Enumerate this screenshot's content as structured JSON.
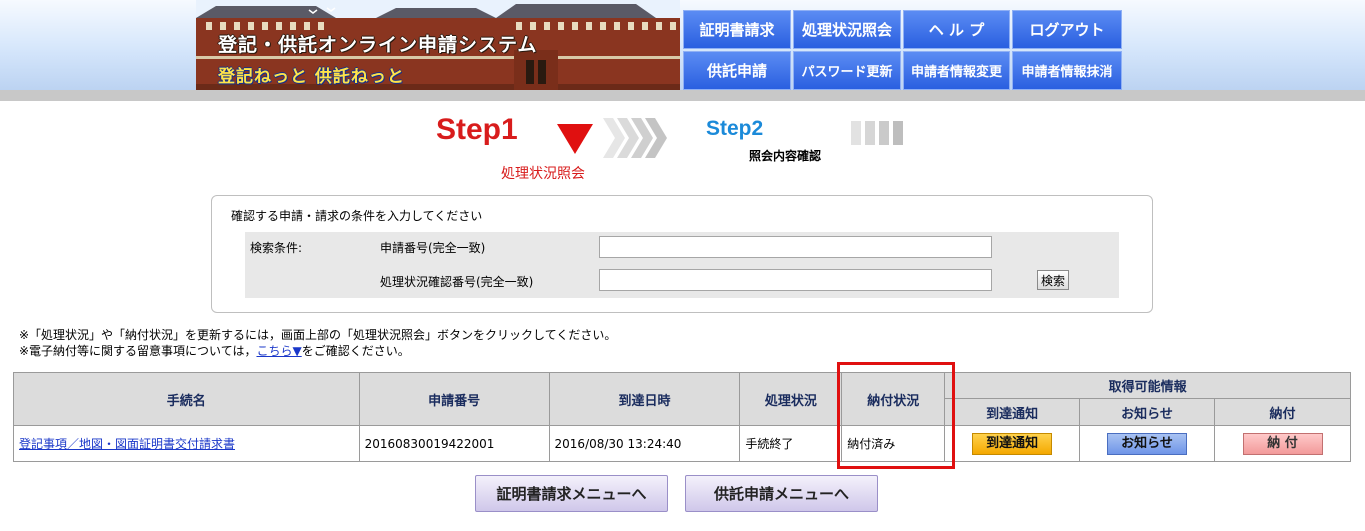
{
  "header": {
    "logo_title": "登記・供託オンライン申請システム",
    "logo_subtitle": "登記ねっと 供託ねっと",
    "nav": {
      "certificate_request": "証明書請求",
      "status_inquiry": "処理状況照会",
      "help": "ヘ ル プ",
      "logout": "ログアウト",
      "deposit_application": "供託申請",
      "password_change": "パスワード更新",
      "applicant_info_change": "申請者情報変更",
      "applicant_info_delete": "申請者情報抹消"
    }
  },
  "steps": {
    "step1_label": "Step1",
    "step1_sub": "処理状況照会",
    "step2_label": "Step2",
    "step2_sub": "照会内容確認"
  },
  "search": {
    "instruction": "確認する申請・請求の条件を入力してください",
    "condition_label": "検索条件:",
    "field1_label": "申請番号(完全一致)",
    "field1_value": "",
    "field2_label": "処理状況確認番号(完全一致)",
    "field2_value": "",
    "search_button": "検索"
  },
  "notes": {
    "line1": "※「処理状況」や「納付状況」を更新するには，画面上部の「処理状況照会」ボタンをクリックしてください。",
    "line2_before": "※電子納付等に関する留意事項については，",
    "line2_link": "こちら▼",
    "line2_after": "をご確認ください。"
  },
  "table": {
    "headers": {
      "procedure": "手続名",
      "application_no": "申請番号",
      "arrival_datetime": "到達日時",
      "process_status": "処理状況",
      "payment_status": "納付状況",
      "available_info": "取得可能情報",
      "arrival_notice": "到達通知",
      "notice": "お知らせ",
      "payment": "納付"
    },
    "rows": [
      {
        "procedure": "登記事項／地図・図面証明書交付請求書",
        "application_no": "20160830019422001",
        "arrival_datetime": "2016/08/30 13:24:40",
        "process_status": "手続終了",
        "payment_status": "納付済み",
        "arrival_notice_btn": "到達通知",
        "notice_btn": "お知らせ",
        "payment_btn": "納 付"
      }
    ]
  },
  "bottom": {
    "certificate_menu": "証明書請求メニューへ",
    "deposit_menu": "供託申請メニューへ"
  },
  "colors": {
    "nav_blue": "#2a5fe0",
    "step_red": "#d81c1c",
    "step_blue": "#1b8ad9",
    "highlight_red": "#e01010"
  }
}
